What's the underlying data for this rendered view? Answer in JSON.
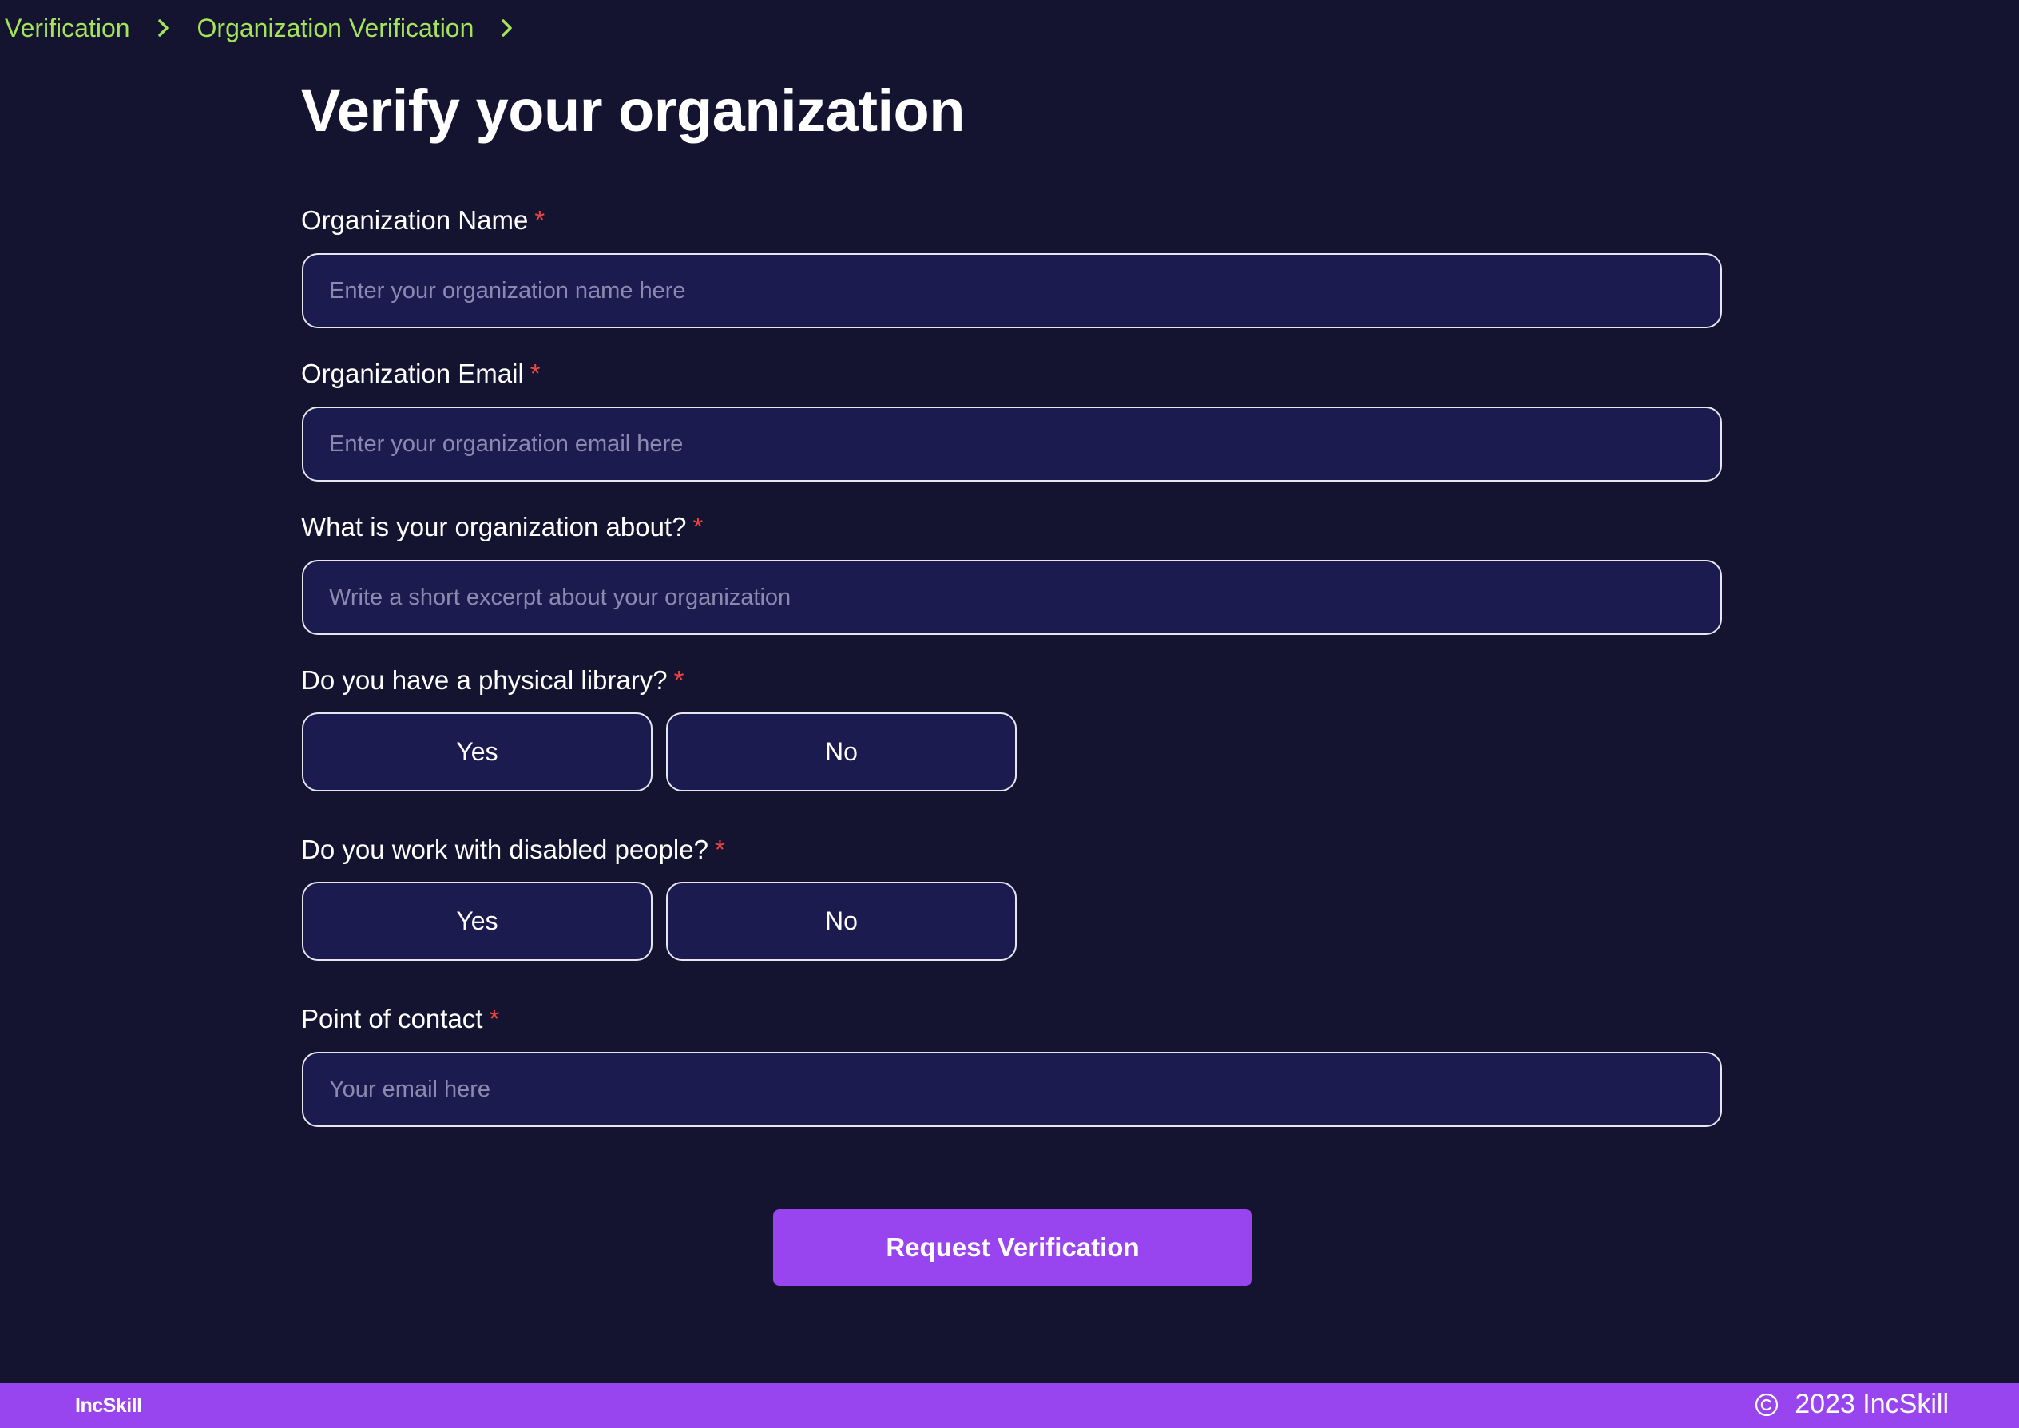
{
  "breadcrumb": {
    "items": [
      {
        "label": "Verification"
      },
      {
        "label": "Organization Verification"
      }
    ],
    "separator_icon": "chevron-right-icon",
    "color": "#a3e45a"
  },
  "page": {
    "title": "Verify your organization"
  },
  "form": {
    "required_marker": "*",
    "org_name": {
      "label": "Organization Name",
      "placeholder": "Enter your organization name here",
      "value": ""
    },
    "org_email": {
      "label": "Organization Email",
      "placeholder": "Enter your organization email here",
      "value": ""
    },
    "org_about": {
      "label": "What is your organization about?",
      "placeholder": "Write a short excerpt about your organization",
      "value": ""
    },
    "physical_library": {
      "label": "Do you have a physical library?",
      "yes_label": "Yes",
      "no_label": "No"
    },
    "disabled_people": {
      "label": "Do you work with disabled people?",
      "yes_label": "Yes",
      "no_label": "No"
    },
    "point_of_contact": {
      "label": "Point of contact",
      "placeholder": "Your email here",
      "value": ""
    },
    "submit_label": "Request Verification"
  },
  "footer": {
    "logo_text": "IncSkill",
    "copyright_icon": "copyright-icon",
    "copyright_text": "2023 IncSkill"
  },
  "colors": {
    "background": "#141431",
    "input_background": "#1b1b4f",
    "accent": "#9945ef",
    "breadcrumb": "#a3e45a",
    "required": "#ef4444"
  }
}
